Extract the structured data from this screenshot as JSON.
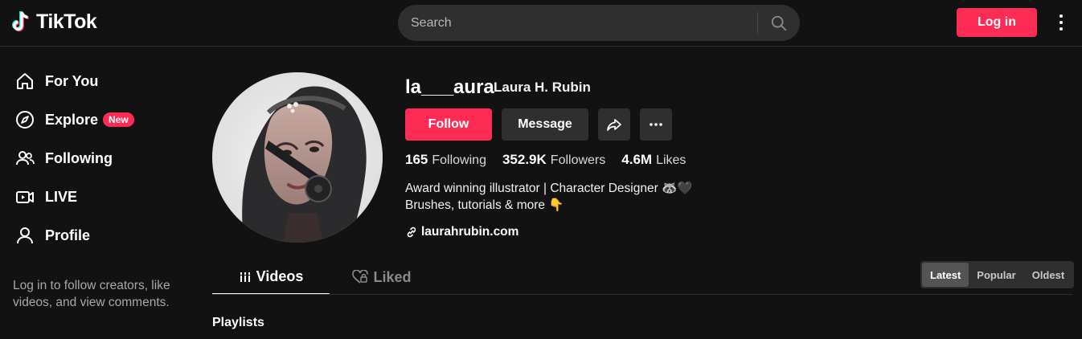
{
  "header": {
    "logo_text": "TikTok",
    "search_placeholder": "Search",
    "login_label": "Log in",
    "brand_color": "#fe2c55"
  },
  "sidebar": {
    "items": [
      {
        "label": "For You",
        "icon": "home-icon"
      },
      {
        "label": "Explore",
        "icon": "compass-icon",
        "badge": "New"
      },
      {
        "label": "Following",
        "icon": "people-icon"
      },
      {
        "label": "LIVE",
        "icon": "live-icon"
      },
      {
        "label": "Profile",
        "icon": "person-icon"
      }
    ],
    "login_note": "Log in to follow creators, like videos, and view comments."
  },
  "profile": {
    "username": "la___aura",
    "full_name": "Laura H. Rubin",
    "follow_label": "Follow",
    "message_label": "Message",
    "stats": [
      {
        "value": "165",
        "label": "Following"
      },
      {
        "value": "352.9K",
        "label": "Followers"
      },
      {
        "value": "4.6M",
        "label": "Likes"
      }
    ],
    "bio": [
      "Award winning illustrator | Character Designer 🦝🖤",
      "Brushes, tutorials & more 👇"
    ],
    "link": "laurahrubin.com"
  },
  "tabs": {
    "videos": "Videos",
    "liked": "Liked"
  },
  "sort": {
    "options": [
      "Latest",
      "Popular",
      "Oldest"
    ],
    "selected": "Latest"
  },
  "section": {
    "playlists": "Playlists"
  }
}
